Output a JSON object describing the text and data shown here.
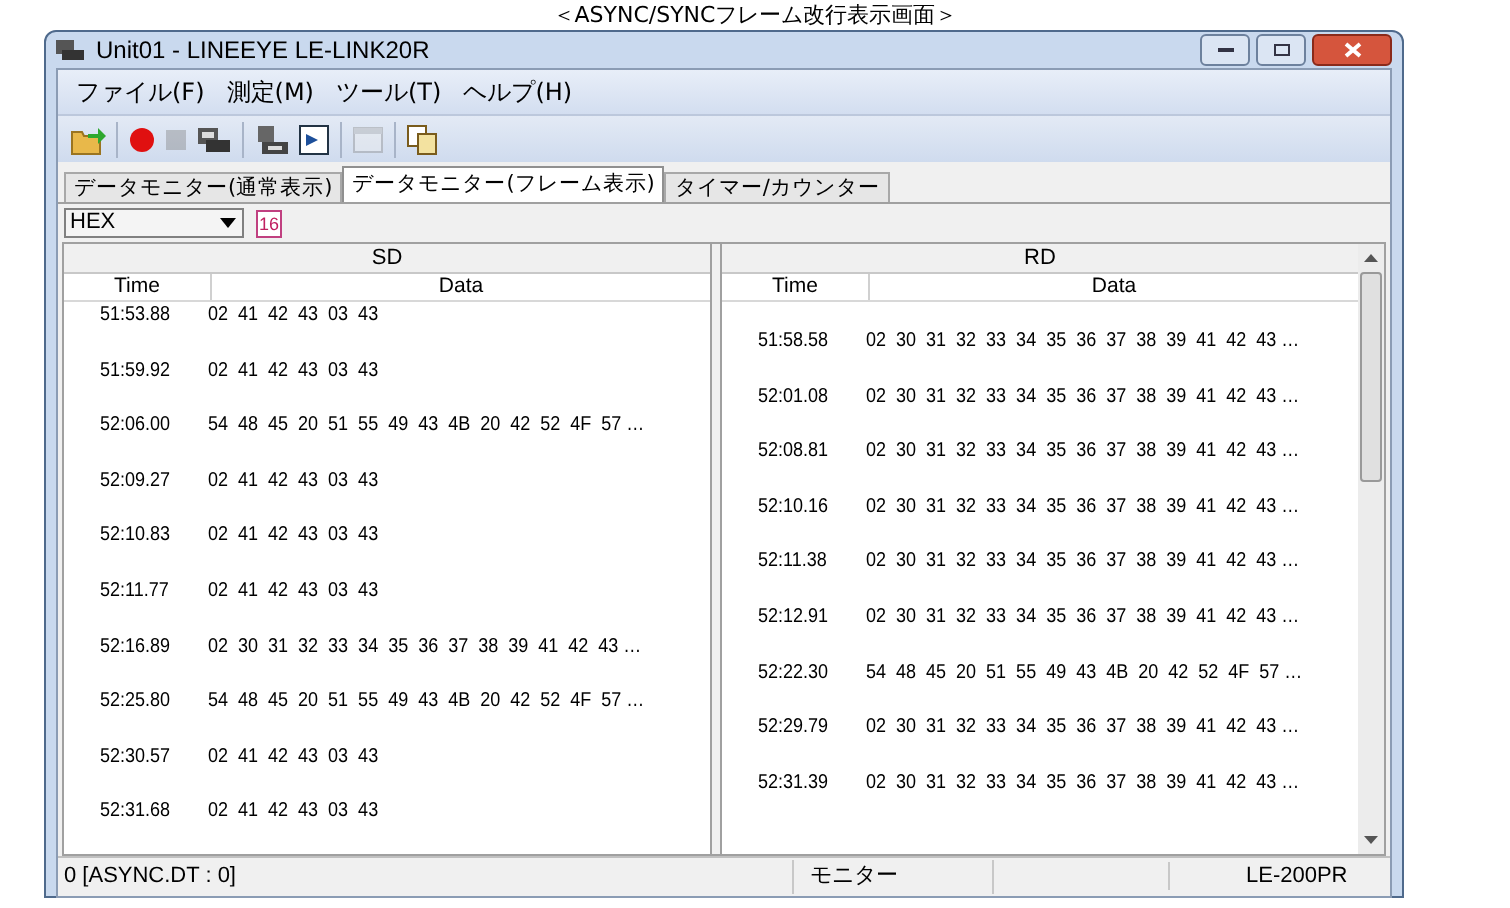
{
  "caption": "＜ASYNC/SYNCフレーム改行表示画面＞",
  "window": {
    "title": "Unit01 - LINEEYE LE-LINK20R"
  },
  "menu": [
    "ファイル(F)",
    "測定(M)",
    "ツール(T)",
    "ヘルプ(H)"
  ],
  "toolbar": [
    {
      "kind": "open",
      "disabled": false
    },
    {
      "kind": "sep"
    },
    {
      "kind": "record",
      "disabled": false
    },
    {
      "kind": "stop",
      "disabled": true
    },
    {
      "kind": "device",
      "disabled": false
    },
    {
      "kind": "sep"
    },
    {
      "kind": "device2",
      "disabled": false
    },
    {
      "kind": "monitor",
      "disabled": false
    },
    {
      "kind": "sep"
    },
    {
      "kind": "panel",
      "disabled": true
    },
    {
      "kind": "sep"
    },
    {
      "kind": "copy",
      "disabled": false
    }
  ],
  "tabs": [
    {
      "label": "データモニター(通常表示)",
      "selected": false
    },
    {
      "label": "データモニター(フレーム表示)",
      "selected": true
    },
    {
      "label": "タイマー/カウンター",
      "selected": false
    }
  ],
  "format": {
    "value": "HEX",
    "badge": "16"
  },
  "panes": [
    {
      "title": "SD",
      "columns": [
        "Time",
        "Data"
      ],
      "rows": [
        [
          "51:53.88",
          "02  41  42  43  03  43"
        ],
        [
          "51:59.92",
          "02  41  42  43  03  43"
        ],
        [
          "52:06.00",
          "54  48  45  20  51  55  49  43  4B  20  42  52  4F  57 …"
        ],
        [
          "52:09.27",
          "02  41  42  43  03  43"
        ],
        [
          "52:10.83",
          "02  41  42  43  03  43"
        ],
        [
          "52:11.77",
          "02  41  42  43  03  43"
        ],
        [
          "52:16.89",
          "02  30  31  32  33  34  35  36  37  38  39  41  42  43 …"
        ],
        [
          "52:25.80",
          "54  48  45  20  51  55  49  43  4B  20  42  52  4F  57 …"
        ],
        [
          "52:30.57",
          "02  41  42  43  03  43"
        ],
        [
          "52:31.68",
          "02  41  42  43  03  43"
        ]
      ]
    },
    {
      "title": "RD",
      "columns": [
        "Time",
        "Data"
      ],
      "rows": [
        [
          "51:58.58",
          "02  30  31  32  33  34  35  36  37  38  39  41  42  43 …"
        ],
        [
          "52:01.08",
          "02  30  31  32  33  34  35  36  37  38  39  41  42  43 …"
        ],
        [
          "52:08.81",
          "02  30  31  32  33  34  35  36  37  38  39  41  42  43 …"
        ],
        [
          "52:10.16",
          "02  30  31  32  33  34  35  36  37  38  39  41  42  43 …"
        ],
        [
          "52:11.38",
          "02  30  31  32  33  34  35  36  37  38  39  41  42  43 …"
        ],
        [
          "52:12.91",
          "02  30  31  32  33  34  35  36  37  38  39  41  42  43 …"
        ],
        [
          "52:22.30",
          "54  48  45  20  51  55  49  43  4B  20  42  52  4F  57 …"
        ],
        [
          "52:29.79",
          "02  30  31  32  33  34  35  36  37  38  39  41  42  43 …"
        ],
        [
          "52:31.39",
          "02  30  31  32  33  34  35  36  37  38  39  41  42  43 …"
        ]
      ]
    }
  ],
  "status_bar": [
    "0 [ASYNC.DT : 0]",
    "モニター",
    "LE-200PR"
  ]
}
